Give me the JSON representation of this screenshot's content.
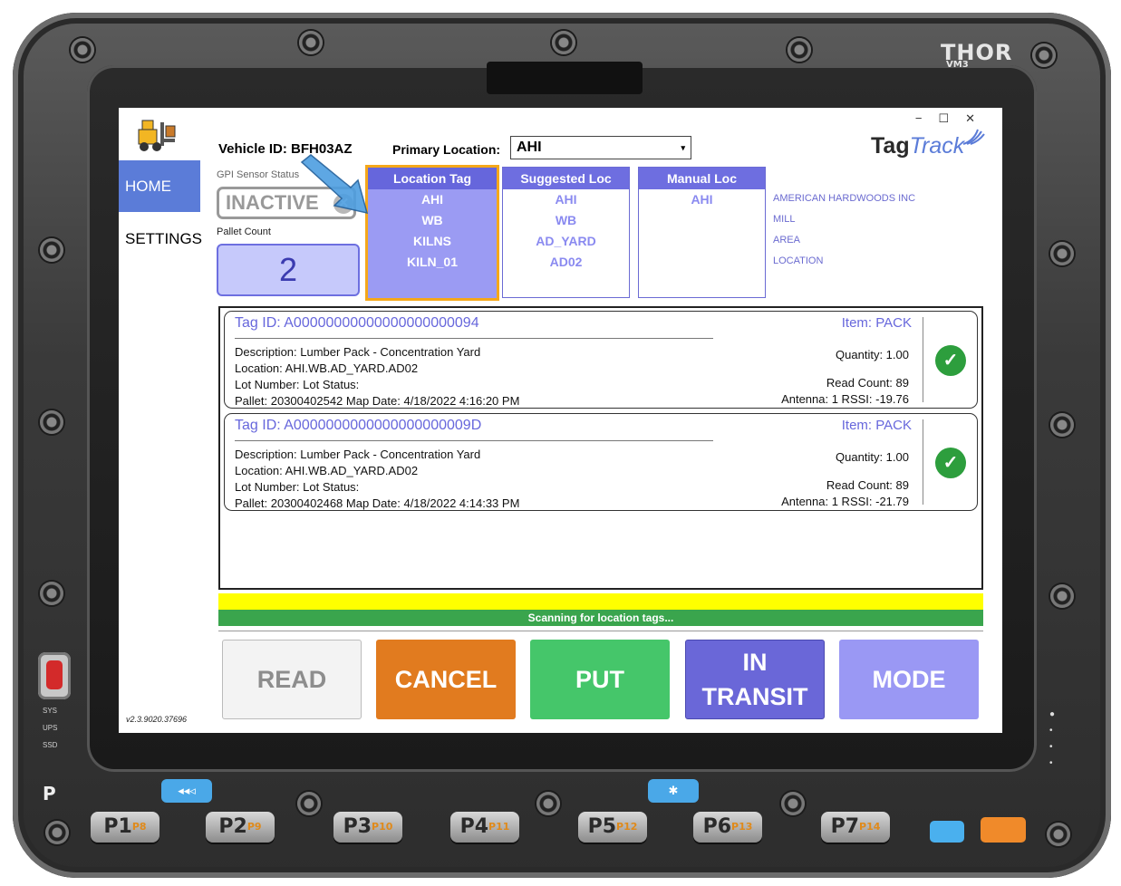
{
  "device": {
    "brand": "THOR",
    "model": "VM3",
    "led_labels": [
      "SYS",
      "UPS",
      "SSD"
    ],
    "p_label": "P",
    "keys": [
      {
        "label": "P1",
        "sub": "P8"
      },
      {
        "label": "P2",
        "sub": "P9"
      },
      {
        "label": "P3",
        "sub": "P10"
      },
      {
        "label": "P4",
        "sub": "P11"
      },
      {
        "label": "P5",
        "sub": "P12"
      },
      {
        "label": "P6",
        "sub": "P13"
      },
      {
        "label": "P7",
        "sub": "P14"
      }
    ],
    "accent_blue": "#4aa8e8",
    "accent_orange": "#f08a2a"
  },
  "window": {
    "controls": [
      "−",
      "☐",
      "✕"
    ]
  },
  "sidebar": {
    "items": [
      {
        "label": "HOME",
        "active": true
      },
      {
        "label": "SETTINGS",
        "active": false
      }
    ],
    "version": "v2.3.9020.37696"
  },
  "header": {
    "vehicle": "Vehicle ID: BFH03AZ",
    "primary_label": "Primary Location:",
    "primary_value": "AHI",
    "logo_tag": "Tag",
    "logo_track": "Track"
  },
  "gpi": {
    "label": "GPI Sensor Status",
    "status": "INACTIVE"
  },
  "pallet": {
    "label": "Pallet Count",
    "count": "2"
  },
  "location_columns": {
    "tag": {
      "header": "Location Tag",
      "values": [
        "AHI",
        "WB",
        "KILNS",
        "KILN_01"
      ]
    },
    "suggested": {
      "header": "Suggested Loc",
      "values": [
        "AHI",
        "WB",
        "AD_YARD",
        "AD02"
      ]
    },
    "manual": {
      "header": "Manual Loc",
      "values": [
        "AHI"
      ]
    },
    "levels": [
      "AMERICAN HARDWOODS INC",
      "MILL",
      "AREA",
      "LOCATION"
    ]
  },
  "tags": [
    {
      "tag_id": "Tag ID: A00000000000000000000094",
      "description": "Description: Lumber Pack - Concentration Yard",
      "location": "Location: AHI.WB.AD_YARD.AD02",
      "lot": "Lot Number:     Lot Status:",
      "pallet": "Pallet: 20300402542    Map Date: 4/18/2022 4:16:20 PM",
      "item": "Item: PACK",
      "quantity": "Quantity: 1.00",
      "read_count": "Read Count: 89",
      "antenna": "Antenna: 1  RSSI: -19.76"
    },
    {
      "tag_id": "Tag ID: A0000000000000000000009D",
      "description": "Description: Lumber Pack - Concentration Yard",
      "location": "Location: AHI.WB.AD_YARD.AD02",
      "lot": "Lot Number:     Lot Status:",
      "pallet": "Pallet: 20300402468    Map Date: 4/18/2022 4:14:33 PM",
      "item": "Item: PACK",
      "quantity": "Quantity: 1.00",
      "read_count": "Read Count: 89",
      "antenna": "Antenna: 1  RSSI: -21.79"
    }
  ],
  "status": {
    "message": "Scanning for location tags..."
  },
  "actions": {
    "read": "READ",
    "cancel": "CANCEL",
    "put": "PUT",
    "in_transit_1": "IN",
    "in_transit_2": "TRANSIT",
    "mode": "MODE"
  }
}
